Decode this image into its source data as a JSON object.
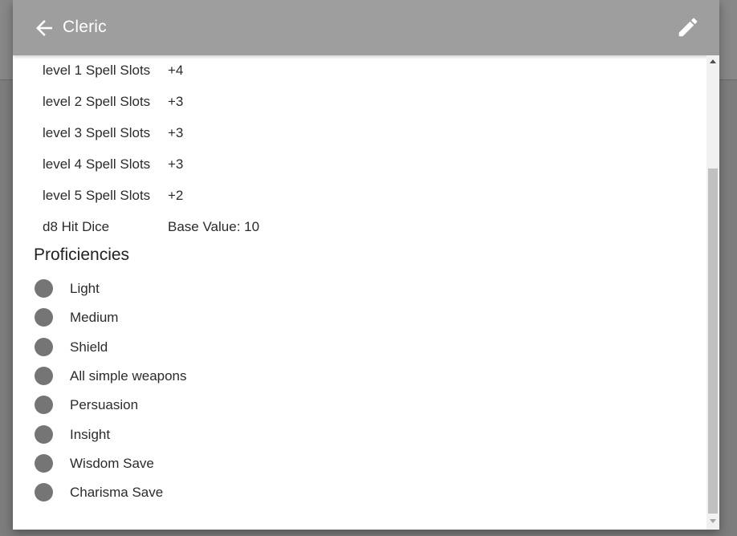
{
  "appbar": {
    "title": "Cleric",
    "back_icon": "arrow-back-icon",
    "edit_icon": "pencil-icon"
  },
  "stats": [
    {
      "label": "level 1 Spell Slots",
      "value": "+4"
    },
    {
      "label": "level 2 Spell Slots",
      "value": "+3"
    },
    {
      "label": "level 3 Spell Slots",
      "value": "+3"
    },
    {
      "label": "level 4 Spell Slots",
      "value": "+3"
    },
    {
      "label": "level 5 Spell Slots",
      "value": "+2"
    },
    {
      "label": "d8 Hit Dice",
      "value": "Base Value: 10"
    }
  ],
  "proficiencies": {
    "heading": "Proficiencies",
    "items": [
      "Light",
      "Medium",
      "Shield",
      "All simple weapons",
      "Persuasion",
      "Insight",
      "Wisdom Save",
      "Charisma Save"
    ]
  },
  "colors": {
    "appbar": "#9e9e9e",
    "dot": "#757575",
    "backdrop": "#7d7d7d"
  }
}
